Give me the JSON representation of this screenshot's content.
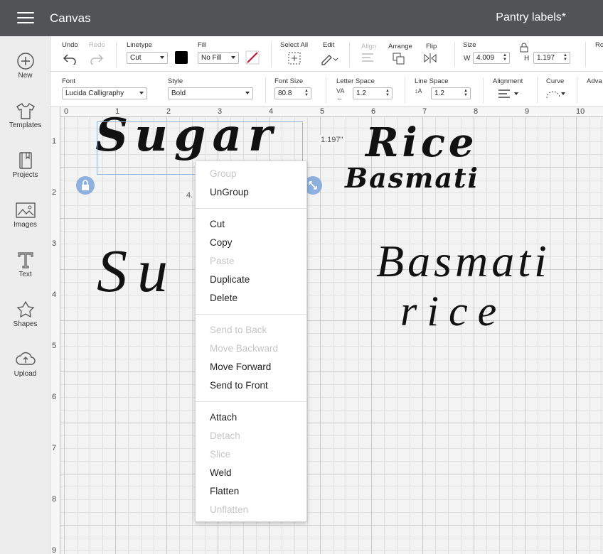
{
  "app": {
    "title": "Canvas",
    "document_title": "Pantry labels*"
  },
  "sidebar": {
    "items": [
      {
        "label": "New",
        "icon": "plus-circle-icon"
      },
      {
        "label": "Templates",
        "icon": "shirt-icon"
      },
      {
        "label": "Projects",
        "icon": "book-icon"
      },
      {
        "label": "Images",
        "icon": "image-icon"
      },
      {
        "label": "Text",
        "icon": "text-icon"
      },
      {
        "label": "Shapes",
        "icon": "shapes-icon"
      },
      {
        "label": "Upload",
        "icon": "cloud-upload-icon"
      }
    ]
  },
  "toolbar": {
    "undo": "Undo",
    "redo": "Redo",
    "linetype_label": "Linetype",
    "linetype_value": "Cut",
    "fill_label": "Fill",
    "fill_value": "No Fill",
    "select_all": "Select All",
    "edit": "Edit",
    "align": "Align",
    "arrange": "Arrange",
    "flip": "Flip",
    "size_label": "Size",
    "w_label": "W",
    "w_value": "4.009",
    "h_label": "H",
    "h_value": "1.197",
    "rotate_label": "Ro",
    "line_color": "#000000",
    "accent_color": "#c8102e"
  },
  "text_toolbar": {
    "font_label": "Font",
    "font_value": "Lucida Calligraphy",
    "style_label": "Style",
    "style_value": "Bold",
    "font_size_label": "Font Size",
    "font_size_value": "80.8",
    "letter_space_label": "Letter Space",
    "letter_space_value": "1.2",
    "line_space_label": "Line Space",
    "line_space_value": "1.2",
    "alignment_label": "Alignment",
    "curve_label": "Curve",
    "advanced_label": "Adva"
  },
  "canvas": {
    "ruler_top": [
      "0",
      "1",
      "2",
      "3",
      "4",
      "5",
      "6",
      "7",
      "8",
      "9",
      "10"
    ],
    "ruler_left": [
      "1",
      "2",
      "3",
      "4",
      "5",
      "6",
      "7",
      "8",
      "9"
    ],
    "texts": {
      "sugar1": "Sugar",
      "rice": "Rice",
      "basmati1": "Basmati",
      "sugar2": "Su",
      "basmati2": "Basmati",
      "rice2": "rice"
    },
    "height_label": "1.197\"",
    "width_label": "4."
  },
  "context_menu": {
    "groups": [
      [
        {
          "label": "Group",
          "enabled": false
        },
        {
          "label": "UnGroup",
          "enabled": true
        }
      ],
      [
        {
          "label": "Cut",
          "enabled": true
        },
        {
          "label": "Copy",
          "enabled": true
        },
        {
          "label": "Paste",
          "enabled": false
        },
        {
          "label": "Duplicate",
          "enabled": true
        },
        {
          "label": "Delete",
          "enabled": true
        }
      ],
      [
        {
          "label": "Send to Back",
          "enabled": false
        },
        {
          "label": "Move Backward",
          "enabled": false
        },
        {
          "label": "Move Forward",
          "enabled": true
        },
        {
          "label": "Send to Front",
          "enabled": true
        }
      ],
      [
        {
          "label": "Attach",
          "enabled": true
        },
        {
          "label": "Detach",
          "enabled": false
        },
        {
          "label": "Slice",
          "enabled": false
        },
        {
          "label": "Weld",
          "enabled": true
        },
        {
          "label": "Flatten",
          "enabled": true
        },
        {
          "label": "Unflatten",
          "enabled": false
        }
      ]
    ]
  }
}
